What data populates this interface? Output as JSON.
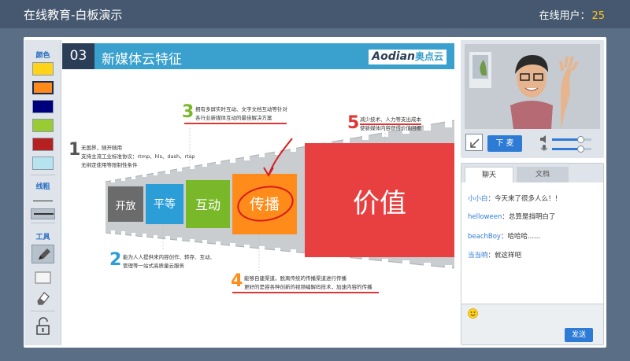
{
  "header": {
    "title": "在线教育-白板演示",
    "online_label": "在线用户：",
    "online_count": "25"
  },
  "toolbar": {
    "color_label": "颜色",
    "colors": [
      "#ffd31a",
      "#ff8a1a",
      "#00007f",
      "#99cc33",
      "#b52121",
      "#b7e3ee"
    ],
    "selected_color_index": 1,
    "thickness_label": "线粗",
    "tools_label": "工具",
    "icons": [
      "pen-icon",
      "rectangle-icon",
      "eraser-icon",
      "unlock-icon"
    ]
  },
  "slide": {
    "number": "03",
    "title": "新媒体云特征",
    "logo_text": "Aodian",
    "logo_cn": "奥点云",
    "frames": [
      "开放",
      "平等",
      "互动",
      "传播",
      "价值"
    ],
    "notes": [
      {
        "num": "1",
        "lines": [
          "无国界，随开随用",
          "支持主流工业标准协议：rtmp、hls、dash、rtsp",
          "无绑定使用等限制性条件"
        ]
      },
      {
        "num": "2",
        "lines": [
          "能为人人提供来内容创作、转存、互动、",
          "管理等一站式高质量云服务"
        ]
      },
      {
        "num": "3",
        "lines": [
          "拥有多屏实时互动、文字文档互动等针对",
          "各行业新媒体互动的最佳解决方案"
        ]
      },
      {
        "num": "4",
        "lines": [
          "能够自建渠道，脱离传统的传播渠道进行传播",
          "更好的是容各种创新的视频编解码技术，加速内容的传播"
        ]
      },
      {
        "num": "5",
        "lines": [
          "减少技术、人力等支出成本",
          "使新媒体内容获得价值回报"
        ]
      }
    ],
    "note_colors": [
      "#555555",
      "#2b9ed8",
      "#79b829",
      "#ff8c1a",
      "#e03535"
    ]
  },
  "video": {
    "mic_button": "下 麦",
    "volume_level": 0.72,
    "mic_level": 0.72
  },
  "chat": {
    "tabs": [
      "聊天",
      "文档"
    ],
    "messages": [
      {
        "user": "小小白",
        "text": "：今天来了很多人么！！"
      },
      {
        "user": "helloween",
        "text": "：总算是挡明白了"
      },
      {
        "user": "beachBoy",
        "text": "：哈哈哈......"
      },
      {
        "user": "当当响",
        "text": "：就这样吧"
      }
    ],
    "send_button": "发送"
  },
  "colors": {
    "accent": "#2e7bd6",
    "header_bg": "#46586f",
    "page_bg": "#5a6e86",
    "online_count": "#ffc21a"
  }
}
